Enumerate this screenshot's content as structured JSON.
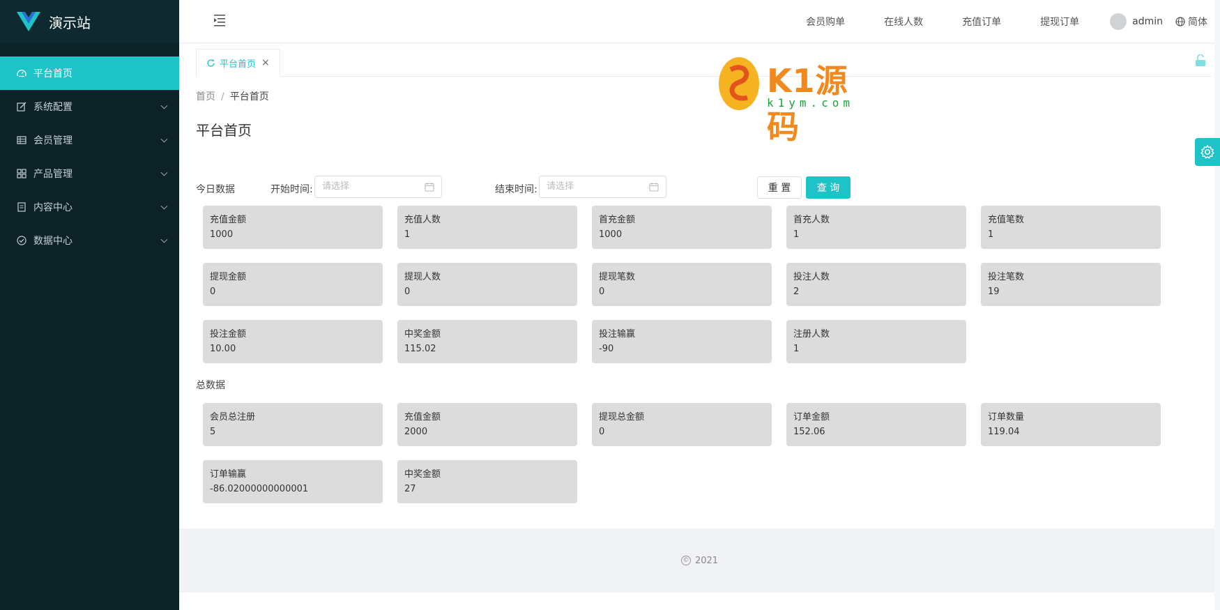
{
  "app": {
    "title": "演示站"
  },
  "sidebar": {
    "items": [
      {
        "label": "平台首页",
        "icon": "dashboard-icon",
        "active": true
      },
      {
        "label": "系统配置",
        "icon": "edit-icon"
      },
      {
        "label": "会员管理",
        "icon": "table-icon"
      },
      {
        "label": "产品管理",
        "icon": "grid-icon"
      },
      {
        "label": "内容中心",
        "icon": "document-icon"
      },
      {
        "label": "数据中心",
        "icon": "check-circle-icon"
      }
    ]
  },
  "header": {
    "links": [
      "会员购单",
      "在线人数",
      "充值订单",
      "提现订单"
    ],
    "user": "admin",
    "language": "简体"
  },
  "tabs": [
    {
      "label": "平台首页",
      "close": "×"
    }
  ],
  "breadcrumb": {
    "home": "首页",
    "separator": "/",
    "current": "平台首页"
  },
  "page_title": "平台首页",
  "filter": {
    "section_label": "今日数据",
    "start_label": "开始时间:",
    "start_placeholder": "请选择",
    "end_label": "结束时间:",
    "end_placeholder": "请选择",
    "reset_label": "重 置",
    "query_label": "查 询"
  },
  "today_cards": [
    {
      "title": "充值金额",
      "value": "1000"
    },
    {
      "title": "充值人数",
      "value": "1"
    },
    {
      "title": "首充金额",
      "value": "1000"
    },
    {
      "title": "首充人数",
      "value": "1"
    },
    {
      "title": "充值笔数",
      "value": "1"
    },
    {
      "title": "提现金额",
      "value": "0"
    },
    {
      "title": "提现人数",
      "value": "0"
    },
    {
      "title": "提现笔数",
      "value": "0"
    },
    {
      "title": "投注人数",
      "value": "2"
    },
    {
      "title": "投注笔数",
      "value": "19"
    },
    {
      "title": "投注金额",
      "value": "10.00"
    },
    {
      "title": "中奖金额",
      "value": "115.02"
    },
    {
      "title": "投注输赢",
      "value": "-90"
    },
    {
      "title": "注册人数",
      "value": "1"
    }
  ],
  "total_label": "总数据",
  "total_cards": [
    {
      "title": "会员总注册",
      "value": "5"
    },
    {
      "title": "充值金额",
      "value": "2000"
    },
    {
      "title": "提现总金额",
      "value": "0"
    },
    {
      "title": "订单金额",
      "value": "152.06"
    },
    {
      "title": "订单数量",
      "value": "119.04"
    },
    {
      "title": "订单输赢",
      "value": "-86.02000000000001"
    },
    {
      "title": "中奖金额",
      "value": "27"
    }
  ],
  "footer": {
    "copyright_symbol": "©",
    "year": "2021"
  },
  "watermark": {
    "text": "K1源码",
    "sub": "k1ym.com"
  },
  "colors": {
    "accent": "#1ec3c7",
    "sidebar_bg": "#0c2227",
    "card_bg": "#dcdcdc"
  }
}
